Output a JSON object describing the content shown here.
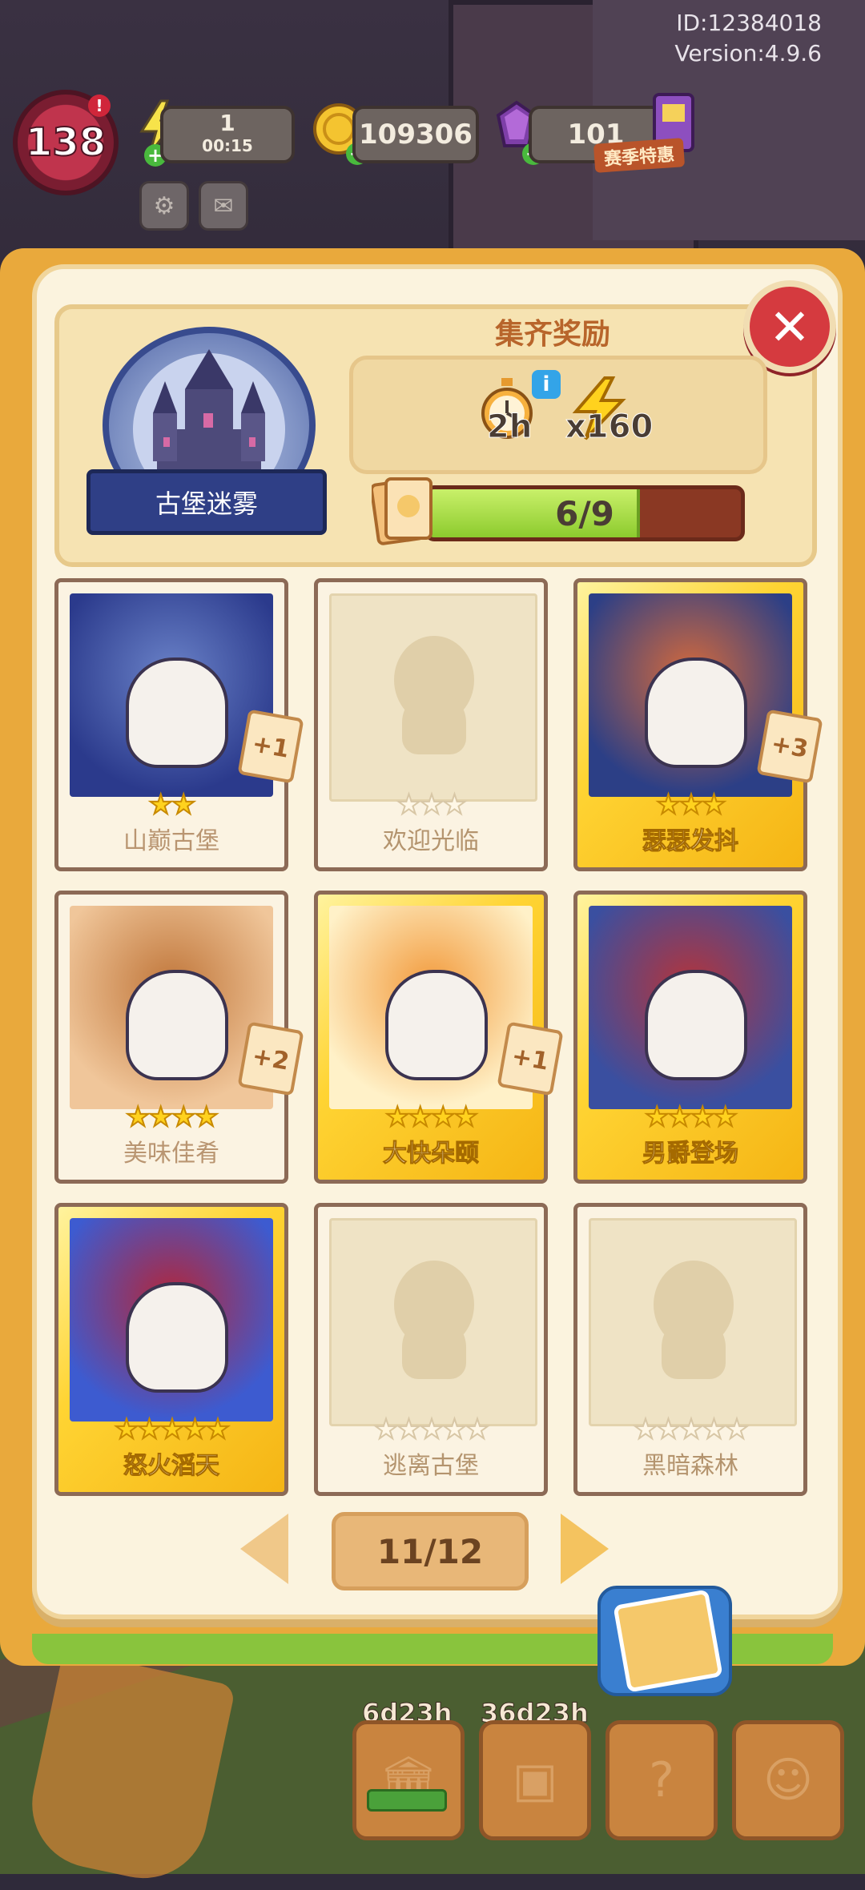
{
  "debug": {
    "id_line": "ID:12384018",
    "version_line": "Version:4.9.6"
  },
  "hud": {
    "level": "138",
    "energy_value": "1",
    "energy_timer": "00:15",
    "coins": "109306",
    "gems": "101",
    "season_label": "赛季特惠",
    "alert": "!"
  },
  "album": {
    "name": "古堡迷雾",
    "reward_title": "集齐奖励",
    "reward_time": "2h",
    "reward_energy": "x160",
    "progress_text": "6/9",
    "progress_fraction": 0.667
  },
  "cards": [
    {
      "name": "山巅古堡",
      "stars": 2,
      "max_stars": 2,
      "dup": "+1",
      "style": "white"
    },
    {
      "name": "欢迎光临",
      "stars": 0,
      "max_stars": 3,
      "dup": "",
      "style": "locked"
    },
    {
      "name": "瑟瑟发抖",
      "stars": 3,
      "max_stars": 3,
      "dup": "+3",
      "style": "gold"
    },
    {
      "name": "美味佳肴",
      "stars": 4,
      "max_stars": 4,
      "dup": "+2",
      "style": "white"
    },
    {
      "name": "大快朵颐",
      "stars": 4,
      "max_stars": 4,
      "dup": "+1",
      "style": "gold"
    },
    {
      "name": "男爵登场",
      "stars": 4,
      "max_stars": 4,
      "dup": "",
      "style": "gold"
    },
    {
      "name": "怒火滔天",
      "stars": 5,
      "max_stars": 5,
      "dup": "",
      "style": "gold"
    },
    {
      "name": "逃离古堡",
      "stars": 0,
      "max_stars": 5,
      "dup": "",
      "style": "locked"
    },
    {
      "name": "黑暗森林",
      "stars": 0,
      "max_stars": 5,
      "dup": "",
      "style": "locked"
    }
  ],
  "pager": {
    "label": "11/12"
  },
  "bottom": {
    "timer_1": "6d23h",
    "timer_2": "36d23h"
  },
  "icons": {
    "close": "close-icon",
    "energy": "lightning-icon",
    "coin": "coin-icon",
    "gem": "gem-icon",
    "settings": "gear-icon",
    "mail": "mail-icon",
    "clock": "stopwatch-icon",
    "info": "info-icon"
  },
  "colors": {
    "accent_gold": "#ffd433",
    "progress_green": "#8ccb2e",
    "close_red": "#d53a3f"
  }
}
